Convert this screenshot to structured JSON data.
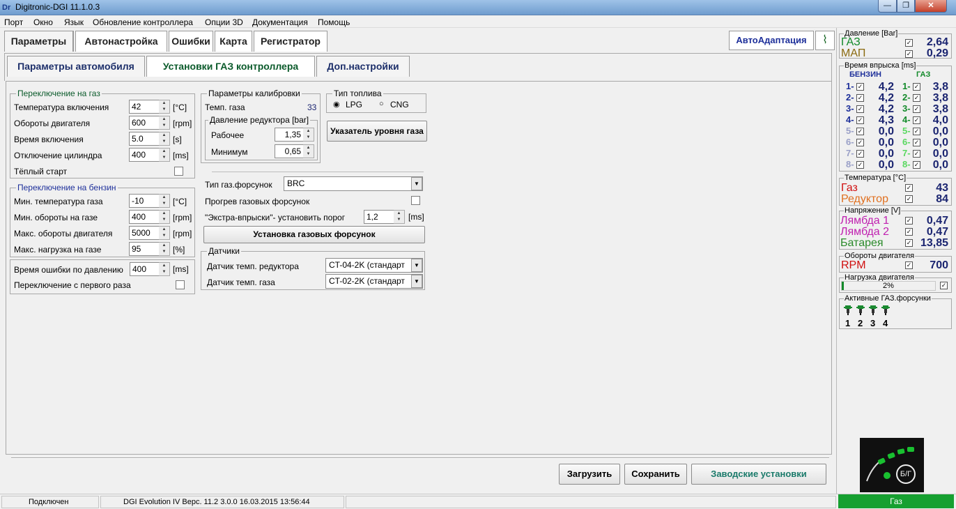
{
  "window": {
    "icon": "Dr",
    "title": "Digitronic-DGI  11.1.0.3",
    "min": "—",
    "max": "❐",
    "close": "✕"
  },
  "menu": [
    "Порт",
    "Окно",
    "Язык",
    "Обновление контроллера",
    "Опции 3D",
    "Документация",
    "Помощь"
  ],
  "tabs": [
    "Параметры",
    "Автонастройка",
    "Ошибки",
    "Карта",
    "Регистратор"
  ],
  "subtabs": [
    "Параметры автомобиля",
    "Установки ГАЗ контроллера",
    "Доп.настройки"
  ],
  "autoadapt": "АвтоАдаптация",
  "switch_gas": {
    "title": "Переключение на газ",
    "rows": [
      {
        "label": "Температура включения",
        "value": "42",
        "unit": "[°C]"
      },
      {
        "label": "Обороты двигателя",
        "value": "600",
        "unit": "[rpm]"
      },
      {
        "label": "Время включения",
        "value": "5.0",
        "unit": "[s]"
      },
      {
        "label": "Отключение цилиндра",
        "value": "400",
        "unit": "[ms]"
      }
    ],
    "warm_start": "Тёплый старт"
  },
  "switch_petrol": {
    "title": "Переключение на бензин",
    "rows": [
      {
        "label": "Мин. температура газа",
        "value": "-10",
        "unit": "[°C]"
      },
      {
        "label": "Мин. обороты на газе",
        "value": "400",
        "unit": "[rpm]"
      },
      {
        "label": "Макс. обороты двигателя",
        "value": "5000",
        "unit": "[rpm]"
      },
      {
        "label": "Макс. нагрузка на газе",
        "value": "95",
        "unit": "[%]"
      }
    ]
  },
  "pressure_error": {
    "label": "Время ошибки по давлению",
    "value": "400",
    "unit": "[ms]",
    "first_switch": "Переключение с первого раза"
  },
  "calib": {
    "title": "Параметры калибровки",
    "gas_temp_label": "Темп. газа",
    "gas_temp_value": "33",
    "reducer_title": "Давление редуктора [bar]",
    "work_label": "Рабочее",
    "work_value": "1,35",
    "min_label": "Минимум",
    "min_value": "0,65"
  },
  "fuel": {
    "title": "Тип топлива",
    "lpg": "LPG",
    "cng": "CNG",
    "level_button": "Указатель уровня газа"
  },
  "injectors": {
    "type_label": "Тип газ.форсунок",
    "type_value": "BRC",
    "warmup_label": "Прогрев газовых форсунок",
    "extra_label": "\"Экстра-впрыски\"- установить порог",
    "extra_value": "1,2",
    "extra_unit": "[ms]",
    "install_button": "Установка газовых форсунок"
  },
  "sensors": {
    "title": "Датчики",
    "reducer_label": "Датчик темп. редуктора",
    "reducer_value": "CT-04-2K (стандарт",
    "gas_label": "Датчик темп. газа",
    "gas_value": "CT-02-2K (стандарт"
  },
  "buttons": {
    "load": "Загрузить",
    "save": "Сохранить",
    "factory": "Заводские установки"
  },
  "right": {
    "pressure": {
      "title": "Давление [Bar]",
      "gas_label": "ГАЗ",
      "gas_value": "2,64",
      "map_label": "МАП",
      "map_value": "0,29"
    },
    "injection": {
      "title": "Время впрыска [ms]",
      "petrol_hdr": "БЕНЗИН",
      "gas_hdr": "ГАЗ",
      "rows": [
        {
          "n": "1-",
          "p": "4,2",
          "g": "3,8"
        },
        {
          "n": "2-",
          "p": "4,2",
          "g": "3,8"
        },
        {
          "n": "3-",
          "p": "4,2",
          "g": "3,8"
        },
        {
          "n": "4-",
          "p": "4,3",
          "g": "4,0"
        },
        {
          "n": "5-",
          "p": "0,0",
          "g": "0,0"
        },
        {
          "n": "6-",
          "p": "0,0",
          "g": "0,0"
        },
        {
          "n": "7-",
          "p": "0,0",
          "g": "0,0"
        },
        {
          "n": "8-",
          "p": "0,0",
          "g": "0,0"
        }
      ]
    },
    "temperature": {
      "title": "Температура  [°C]",
      "gas_label": "Газ",
      "gas_value": "43",
      "red_label": "Редуктор",
      "red_value": "84"
    },
    "voltage": {
      "title": "Напряжение [V]",
      "l1_label": "Лямбда 1",
      "l1_value": "0,47",
      "l2_label": "Лямбда 2",
      "l2_value": "0,47",
      "bat_label": "Батарея",
      "bat_value": "13,85"
    },
    "rpm": {
      "title": "Обороты двигателя",
      "label": "RPM",
      "value": "700"
    },
    "load": {
      "title": "Нагрузка двигателя",
      "value": "2%",
      "fraction": 0.02
    },
    "active": {
      "title": "Активные ГАЗ.форсунки",
      "nums": [
        "1",
        "2",
        "3",
        "4"
      ]
    },
    "logo_text": "Б/Г"
  },
  "status": {
    "conn": "Подключен",
    "version": "DGI Evolution IV  Верс. 11.2  3.0.0      16.03.2015 13:56:44",
    "mode": "Газ"
  },
  "colors": {
    "gas_green": "#138a2a",
    "map_olive": "#8a6a10",
    "lambda": "#c020b0",
    "reducer": "#e07020",
    "rpm_red": "#d01010",
    "battery": "#2a8a2a",
    "value_blue": "#1a2470"
  }
}
